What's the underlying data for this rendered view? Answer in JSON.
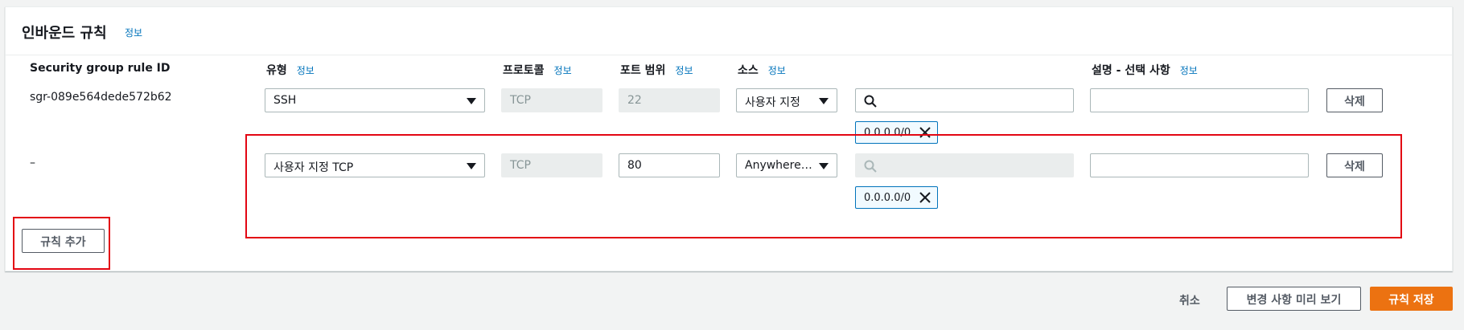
{
  "panel": {
    "title": "인바운드 규칙",
    "info": "정보"
  },
  "columns": {
    "rule_id": "Security group rule ID",
    "type": "유형",
    "type_info": "정보",
    "protocol": "프로토콜",
    "protocol_info": "정보",
    "port_range": "포트 범위",
    "port_info": "정보",
    "source": "소스",
    "source_info": "정보",
    "description": "설명 - 선택 사항",
    "description_info": "정보"
  },
  "rules": [
    {
      "rule_id": "sgr-089e564dede572b62",
      "type": "SSH",
      "protocol": "TCP",
      "port_range": "22",
      "source_type": "사용자 지정",
      "source_search": "",
      "source_token": "0.0.0.0/0",
      "description": "",
      "delete_label": "삭제"
    },
    {
      "rule_id": "–",
      "type": "사용자 지정 TCP",
      "protocol": "TCP",
      "port_range": "80",
      "source_type": "Anywhere-I...",
      "source_search": "",
      "source_token": "0.0.0.0/0",
      "description": "",
      "delete_label": "삭제"
    }
  ],
  "add_rule_label": "규칙 추가",
  "footer": {
    "cancel": "취소",
    "preview": "변경 사항 미리 보기",
    "save": "규칙 저장"
  },
  "colors": {
    "accent": "#ec7211",
    "link": "#0073bb",
    "highlight": "#e30613"
  }
}
